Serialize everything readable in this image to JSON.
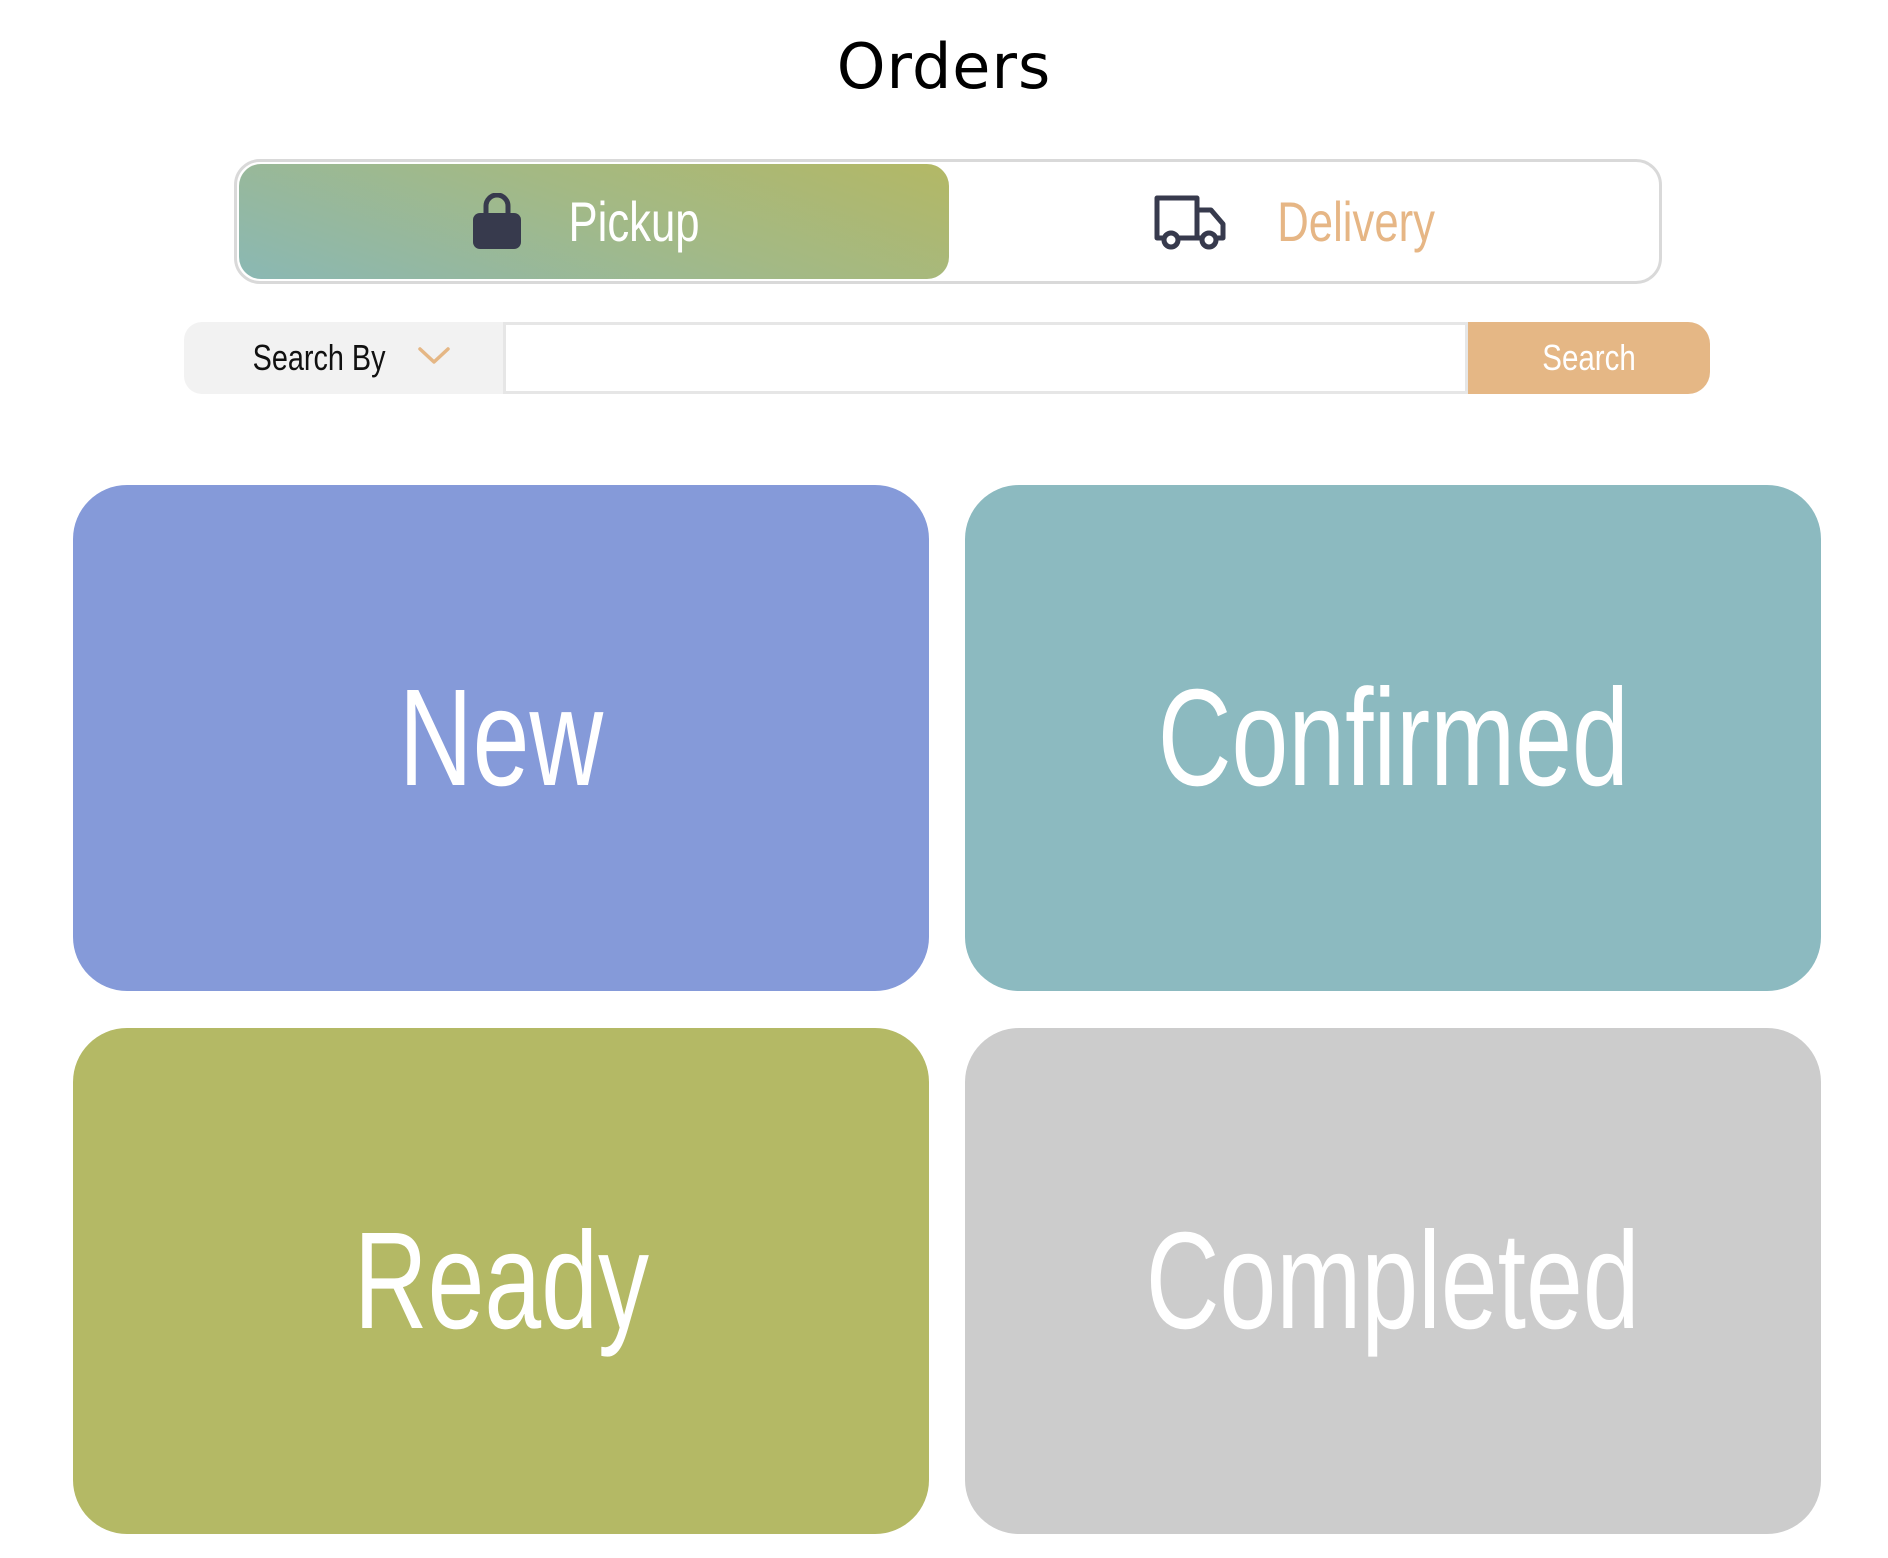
{
  "header": {
    "title": "Orders"
  },
  "order_type_toggle": {
    "selected": "Pickup",
    "pickup": {
      "label": "Pickup",
      "icon": "shopping-bag-icon"
    },
    "delivery": {
      "label": "Delivery",
      "icon": "truck-icon"
    }
  },
  "search": {
    "search_by_label": "Search By",
    "search_by_icon": "chevron-down-icon",
    "input_value": "",
    "button_label": "Search"
  },
  "status_tiles": [
    {
      "label": "New",
      "color": "#859ad9"
    },
    {
      "label": "Confirmed",
      "color": "#8cbac0"
    },
    {
      "label": "Ready",
      "color": "#b4b965"
    },
    {
      "label": "Completed",
      "color": "#cccccc"
    }
  ],
  "colors": {
    "accent": "#e5b785",
    "icon_dark": "#373a4d"
  }
}
